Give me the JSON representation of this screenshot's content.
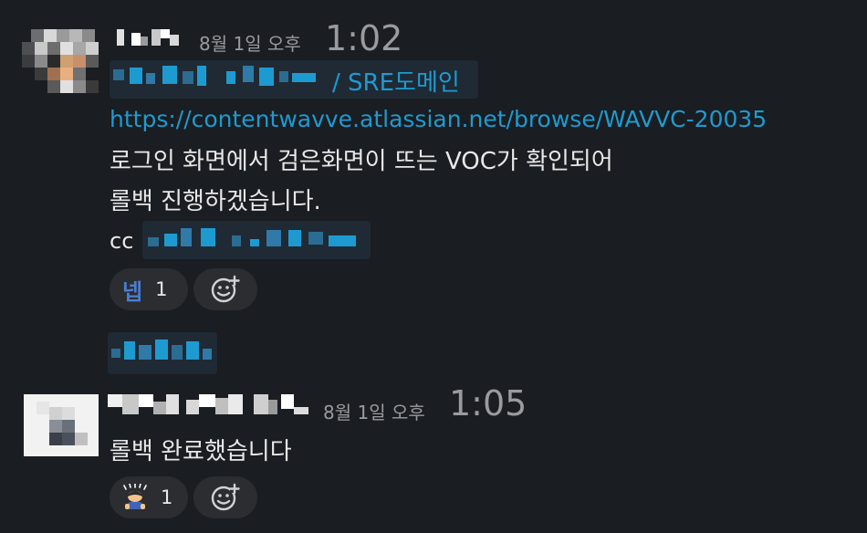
{
  "messages": [
    {
      "date": "8월 1일 오후",
      "time": "1:02",
      "mention_suffix": "/ SRE도메인",
      "link": "https://contentwavve.atlassian.net/browse/WAVVC-20035",
      "lines": [
        "로그인 화면에서 검은화면이 뜨는 VOC가 확인되어",
        "롤백 진행하겠습니다."
      ],
      "cc_label": "cc",
      "reaction": {
        "emoji": "넵",
        "count": "1"
      }
    },
    {
      "date": "8월 1일 오후",
      "time": "1:05",
      "lines": [
        "롤백 완료했습니다"
      ],
      "reaction": {
        "emoji": "person-bowing-emoji",
        "count": "1"
      }
    }
  ],
  "colors": {
    "background": "#1a1d21",
    "link": "#1d9bd1",
    "reaction_bg": "#2b2d31"
  }
}
